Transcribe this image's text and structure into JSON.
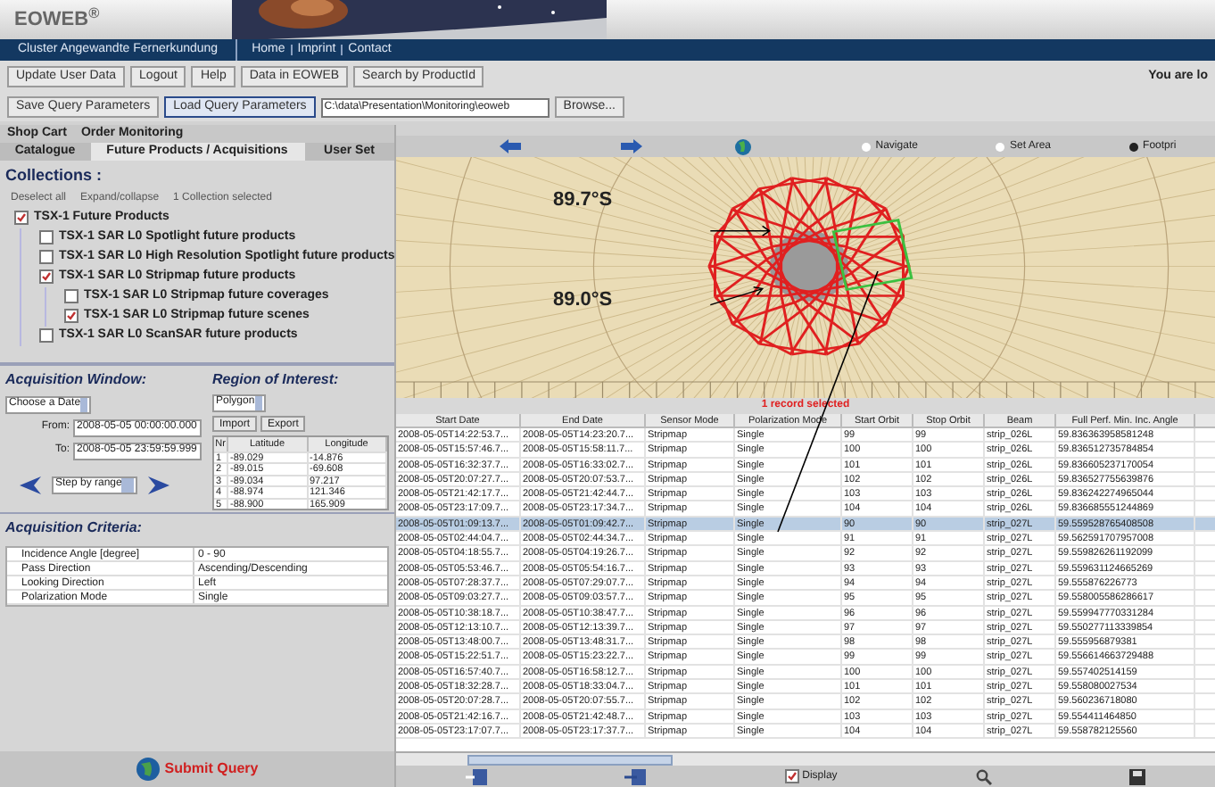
{
  "header": {
    "logo": "EOWEB$^{®}$"
  },
  "nav": {
    "cluster": "Cluster Angewandte Fernerkundung",
    "links": [
      "Home",
      "Imprint",
      "Contact"
    ]
  },
  "toolbar": {
    "buttons": [
      "Update User Data",
      "Logout",
      "Help",
      "Data in EOWEB",
      "Search by ProductId"
    ],
    "user_notice": "You are lo"
  },
  "query_bar": {
    "buttons": [
      {
        "label": "Save Query Parameters",
        "selected": false
      },
      {
        "label": "Load Query Parameters",
        "selected": true
      }
    ],
    "path": "C:\\data\\Presentation\\Monitoring\\eoweb",
    "browse": "Browse..."
  },
  "top_tabs": [
    {
      "label": "Shop Cart",
      "selected": false
    },
    {
      "label": "Order Monitoring",
      "selected": false
    }
  ],
  "tabs": [
    {
      "label": "Catalogue",
      "selected": false
    },
    {
      "label": "Future Products / Acquisitions",
      "selected": true
    },
    {
      "label": "User Set",
      "selected": false
    }
  ],
  "collections": {
    "title": "Collections :",
    "actions": [
      "Deselect all",
      "Expand/collapse"
    ],
    "status": "1 Collection selected",
    "tree": [
      {
        "label": "TSX-1 Future Products",
        "checked": true,
        "children": [
          {
            "label": "TSX-1 SAR L0 Spotlight future products",
            "checked": false
          },
          {
            "label": "TSX-1 SAR L0 High Resolution Spotlight future products",
            "checked": false
          },
          {
            "label": "TSX-1 SAR L0 Stripmap future products",
            "checked": true,
            "children": [
              {
                "label": "TSX-1 SAR L0 Stripmap future coverages",
                "checked": false
              },
              {
                "label": "TSX-1 SAR L0 Stripmap future scenes",
                "checked": true
              }
            ]
          },
          {
            "label": "TSX-1 SAR L0 ScanSAR future products",
            "checked": false
          }
        ]
      }
    ]
  },
  "acquisition_window": {
    "title": "Acquisition Window:",
    "date_select": "Choose a Date",
    "from_label": "From:",
    "from": "2008-05-05 00:00:00.000",
    "to_label": "To:",
    "to": "2008-05-05 23:59:59.999",
    "step": "Step by range"
  },
  "region_of_interest": {
    "title": "Region of Interest:",
    "shape": "Polygon",
    "buttons": [
      "Import",
      "Export"
    ],
    "columns": [
      "Nr",
      "Latitude",
      "Longitude"
    ],
    "rows": [
      [
        "1",
        "-89.029",
        "-14.876"
      ],
      [
        "2",
        "-89.015",
        "-69.608"
      ],
      [
        "3",
        "-89.034",
        "97.217"
      ],
      [
        "4",
        "-88.974",
        "121.346"
      ],
      [
        "5",
        "-88.900",
        "165.909"
      ]
    ]
  },
  "acquisition_criteria": {
    "title": "Acquisition Criteria:",
    "rows": [
      [
        "Incidence Angle [degree]",
        "0 - 90"
      ],
      [
        "Pass Direction",
        "Ascending/Descending"
      ],
      [
        "Looking Direction",
        "Left"
      ],
      [
        "Polarization Mode",
        "Single"
      ]
    ]
  },
  "submit": "Submit Query",
  "map_toolbar": {
    "modes": [
      {
        "label": "Navigate",
        "selected": false
      },
      {
        "label": "Set Area",
        "selected": false
      },
      {
        "label": "Footpri",
        "selected": true
      }
    ]
  },
  "map": {
    "labels": [
      "89.7°S",
      "89.0°S"
    ]
  },
  "selection_status": "1 record selected",
  "table": {
    "columns": [
      "Start Date",
      "End Date",
      "Sensor Mode",
      "Polarization Mode",
      "Start Orbit",
      "Stop Orbit",
      "Beam",
      "Full Perf. Min. Inc. Angle"
    ],
    "rows": [
      {
        "selected": false,
        "cells": [
          "2008-05-05T14:22:53.7...",
          "2008-05-05T14:23:20.7...",
          "Stripmap",
          "Single",
          "99",
          "99",
          "strip_026L",
          "59.836363958581248"
        ]
      },
      {
        "selected": false,
        "cells": [
          "2008-05-05T15:57:46.7...",
          "2008-05-05T15:58:11.7...",
          "Stripmap",
          "Single",
          "100",
          "100",
          "strip_026L",
          "59.836512735784854"
        ]
      },
      {
        "selected": false,
        "cells": [
          "2008-05-05T16:32:37.7...",
          "2008-05-05T16:33:02.7...",
          "Stripmap",
          "Single",
          "101",
          "101",
          "strip_026L",
          "59.836605237170054"
        ]
      },
      {
        "selected": false,
        "cells": [
          "2008-05-05T20:07:27.7...",
          "2008-05-05T20:07:53.7...",
          "Stripmap",
          "Single",
          "102",
          "102",
          "strip_026L",
          "59.836527755639876"
        ]
      },
      {
        "selected": false,
        "cells": [
          "2008-05-05T21:42:17.7...",
          "2008-05-05T21:42:44.7...",
          "Stripmap",
          "Single",
          "103",
          "103",
          "strip_026L",
          "59.836242274965044"
        ]
      },
      {
        "selected": false,
        "cells": [
          "2008-05-05T23:17:09.7...",
          "2008-05-05T23:17:34.7...",
          "Stripmap",
          "Single",
          "104",
          "104",
          "strip_026L",
          "59.836685551244869"
        ]
      },
      {
        "selected": true,
        "cells": [
          "2008-05-05T01:09:13.7...",
          "2008-05-05T01:09:42.7...",
          "Stripmap",
          "Single",
          "90",
          "90",
          "strip_027L",
          "59.559528765408508"
        ]
      },
      {
        "selected": false,
        "cells": [
          "2008-05-05T02:44:04.7...",
          "2008-05-05T02:44:34.7...",
          "Stripmap",
          "Single",
          "91",
          "91",
          "strip_027L",
          "59.562591707957008"
        ]
      },
      {
        "selected": false,
        "cells": [
          "2008-05-05T04:18:55.7...",
          "2008-05-05T04:19:26.7...",
          "Stripmap",
          "Single",
          "92",
          "92",
          "strip_027L",
          "59.559826261192099"
        ]
      },
      {
        "selected": false,
        "cells": [
          "2008-05-05T05:53:46.7...",
          "2008-05-05T05:54:16.7...",
          "Stripmap",
          "Single",
          "93",
          "93",
          "strip_027L",
          "59.559631124665269"
        ]
      },
      {
        "selected": false,
        "cells": [
          "2008-05-05T07:28:37.7...",
          "2008-05-05T07:29:07.7...",
          "Stripmap",
          "Single",
          "94",
          "94",
          "strip_027L",
          "59.555876226773"
        ]
      },
      {
        "selected": false,
        "cells": [
          "2008-05-05T09:03:27.7...",
          "2008-05-05T09:03:57.7...",
          "Stripmap",
          "Single",
          "95",
          "95",
          "strip_027L",
          "59.558005586286617"
        ]
      },
      {
        "selected": false,
        "cells": [
          "2008-05-05T10:38:18.7...",
          "2008-05-05T10:38:47.7...",
          "Stripmap",
          "Single",
          "96",
          "96",
          "strip_027L",
          "59.559947770331284"
        ]
      },
      {
        "selected": false,
        "cells": [
          "2008-05-05T12:13:10.7...",
          "2008-05-05T12:13:39.7...",
          "Stripmap",
          "Single",
          "97",
          "97",
          "strip_027L",
          "59.550277113339854"
        ]
      },
      {
        "selected": false,
        "cells": [
          "2008-05-05T13:48:00.7...",
          "2008-05-05T13:48:31.7...",
          "Stripmap",
          "Single",
          "98",
          "98",
          "strip_027L",
          "59.555956879381"
        ]
      },
      {
        "selected": false,
        "cells": [
          "2008-05-05T15:22:51.7...",
          "2008-05-05T15:23:22.7...",
          "Stripmap",
          "Single",
          "99",
          "99",
          "strip_027L",
          "59.556614663729488"
        ]
      },
      {
        "selected": false,
        "cells": [
          "2008-05-05T16:57:40.7...",
          "2008-05-05T16:58:12.7...",
          "Stripmap",
          "Single",
          "100",
          "100",
          "strip_027L",
          "59.557402514159"
        ]
      },
      {
        "selected": false,
        "cells": [
          "2008-05-05T18:32:28.7...",
          "2008-05-05T18:33:04.7...",
          "Stripmap",
          "Single",
          "101",
          "101",
          "strip_027L",
          "59.558080027534"
        ]
      },
      {
        "selected": false,
        "cells": [
          "2008-05-05T20:07:28.7...",
          "2008-05-05T20:07:55.7...",
          "Stripmap",
          "Single",
          "102",
          "102",
          "strip_027L",
          "59.560236718080"
        ]
      },
      {
        "selected": false,
        "cells": [
          "2008-05-05T21:42:16.7...",
          "2008-05-05T21:42:48.7...",
          "Stripmap",
          "Single",
          "103",
          "103",
          "strip_027L",
          "59.554411464850"
        ]
      },
      {
        "selected": false,
        "cells": [
          "2008-05-05T23:17:07.7...",
          "2008-05-05T23:17:37.7...",
          "Stripmap",
          "Single",
          "104",
          "104",
          "strip_027L",
          "59.558782125560"
        ]
      }
    ]
  },
  "bottom_bar": {
    "display": {
      "label": "Display",
      "checked": true
    }
  }
}
